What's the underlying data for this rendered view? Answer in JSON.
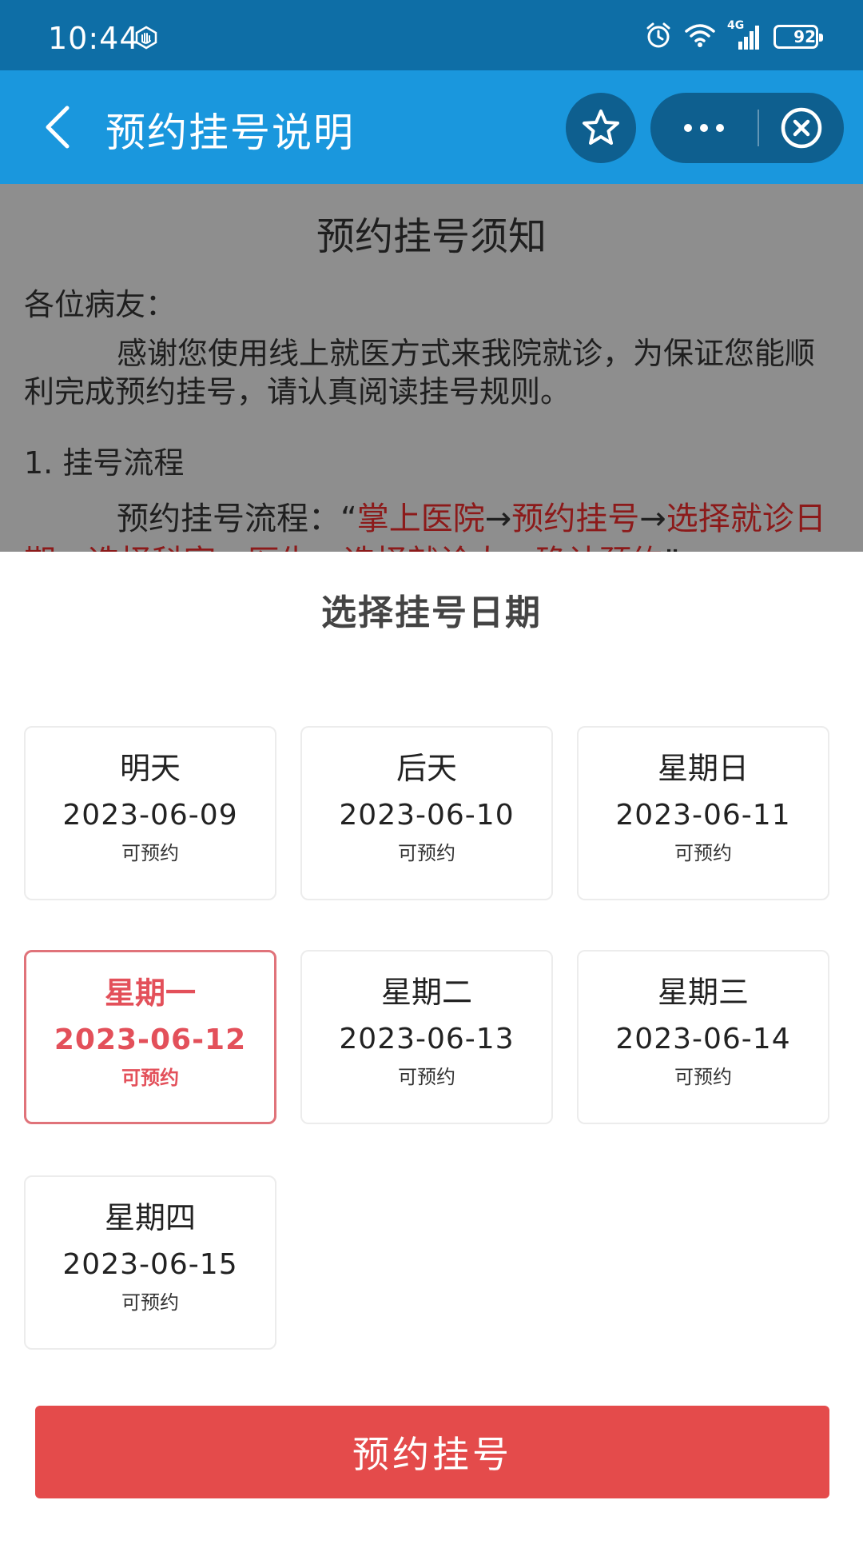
{
  "status_bar": {
    "time": "10:44",
    "network": "4G",
    "battery": "92",
    "battery_level": 0.92
  },
  "title_bar": {
    "title": "预约挂号说明"
  },
  "document": {
    "title": "预约挂号须知",
    "greeting": "各位病友：",
    "para1": "感谢您使用线上就医方式来我院就诊，为保证您能顺利完成预约挂号，请认真阅读挂号规则。",
    "heading1": "1. 挂号流程",
    "para2_prefix": "预约挂号流程：“",
    "para2_s1": "掌上医院",
    "arrow": "→",
    "para2_s2": "预约挂号",
    "para2_s3": "选择就诊日期、选择科室、医生、选择就诊人、确认预约",
    "para2_suffix": "”"
  },
  "sheet": {
    "title": "选择挂号日期",
    "dates": [
      {
        "day": "明天",
        "date": "2023-06-09",
        "status": "可预约",
        "selected": false
      },
      {
        "day": "后天",
        "date": "2023-06-10",
        "status": "可预约",
        "selected": false
      },
      {
        "day": "星期日",
        "date": "2023-06-11",
        "status": "可预约",
        "selected": false
      },
      {
        "day": "星期一",
        "date": "2023-06-12",
        "status": "可预约",
        "selected": true
      },
      {
        "day": "星期二",
        "date": "2023-06-13",
        "status": "可预约",
        "selected": false
      },
      {
        "day": "星期三",
        "date": "2023-06-14",
        "status": "可预约",
        "selected": false
      },
      {
        "day": "星期四",
        "date": "2023-06-15",
        "status": "可预约",
        "selected": false
      }
    ],
    "confirm_label": "预约挂号"
  },
  "colors": {
    "status_bar": "#0e6ea6",
    "title_bar": "#1a97dd",
    "accent_red": "#e44b4b",
    "selected_text": "#e3505a"
  },
  "icons": [
    "hand-icon",
    "alarm-icon",
    "wifi-icon",
    "signal-icon",
    "battery-icon",
    "back-icon",
    "star-icon",
    "more-icon",
    "close-icon"
  ]
}
